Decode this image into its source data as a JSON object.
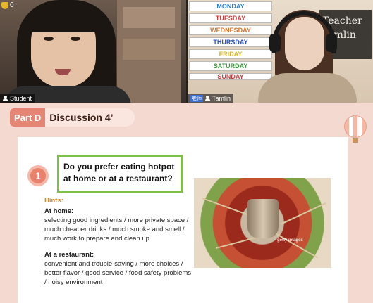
{
  "student_tile": {
    "trophy_count": "0",
    "name": "Student"
  },
  "teacher_tile": {
    "days": [
      "MONDAY",
      "TUESDAY",
      "WEDNESDAY",
      "THURSDAY",
      "FRIDAY",
      "SATURDAY",
      "SUNDAY"
    ],
    "board_text": "Teacher Tamlin",
    "role_badge": "老师",
    "name": "Tamlin"
  },
  "slide": {
    "part_label": "Part D",
    "part_title": "Discussion 4’",
    "question_number": "1",
    "question": "Do you prefer eating hotpot at home or at a restaurant?",
    "hints_label": "Hints:",
    "home_heading": "At home:",
    "home_text": "selecting good ingredients / more private space / much cheaper drinks / much smoke and smell / much work to prepare and clean up",
    "restaurant_heading": "At a restaurant:",
    "restaurant_text": "convenient and trouble-saving / more choices / better flavor / good service / food safety problems / noisy environment",
    "photo_watermark": "getty images"
  },
  "colors": {
    "accent_coral": "#e58675",
    "question_border": "#7cc047",
    "hints_orange": "#e08a2c",
    "slide_background": "#f3d9cf"
  }
}
